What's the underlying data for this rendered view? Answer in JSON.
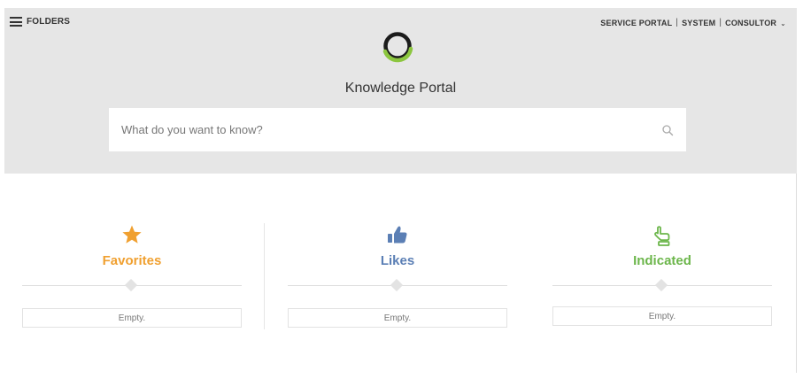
{
  "header": {
    "menu_label": "FOLDERS",
    "nav": {
      "service_portal": "SERVICE PORTAL",
      "system": "SYSTEM",
      "consultor": "CONSULTOR",
      "separator": "|",
      "chevron": "⌄"
    },
    "title": "Knowledge Portal",
    "logo_colors": {
      "dark": "#1b1b1b",
      "green": "#8cc63f"
    }
  },
  "search": {
    "placeholder": "What do you want to know?",
    "icon": "search-icon"
  },
  "sections": {
    "favorites": {
      "title": "Favorites",
      "empty_text": "Empty.",
      "color": "#f0a030",
      "icon": "star-icon"
    },
    "likes": {
      "title": "Likes",
      "empty_text": "Empty.",
      "color": "#5b7fb5",
      "icon": "thumbs-up-icon"
    },
    "indicated": {
      "title": "Indicated",
      "empty_text": "Empty.",
      "color": "#6cb64b",
      "icon": "pointing-hand-icon"
    }
  }
}
